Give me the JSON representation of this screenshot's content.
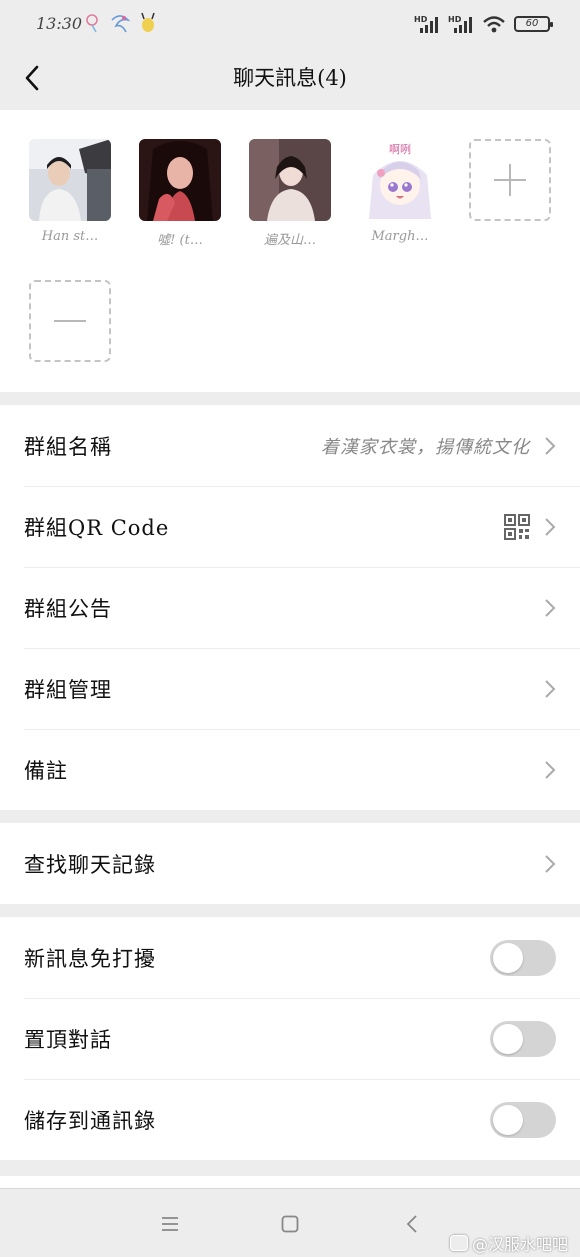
{
  "status_bar": {
    "time": "13:30",
    "network_1": "HD",
    "network_2": "HD",
    "battery": "60"
  },
  "nav": {
    "title": "聊天訊息(4)"
  },
  "members": [
    {
      "name": "Han st…",
      "avatar": "photo-avatar-young-man"
    },
    {
      "name": "噓! (t…",
      "avatar": "photo-avatar-woman-red"
    },
    {
      "name": "遍及山…",
      "avatar": "photo-avatar-woman-hanfu"
    },
    {
      "name": "Margh…",
      "avatar": "anime-avatar-girl"
    }
  ],
  "anime_caption": "啊咧",
  "group_settings": {
    "name_label": "群組名稱",
    "name_value": "着漢家衣裳，揚傳統文化",
    "qr_label": "群組QR Code",
    "notice_label": "群組公告",
    "manage_label": "群組管理",
    "remark_label": "備註"
  },
  "search": {
    "label": "查找聊天記錄"
  },
  "toggles": [
    {
      "label": "新訊息免打擾",
      "on": false
    },
    {
      "label": "置頂對話",
      "on": false
    },
    {
      "label": "儲存到通訊錄",
      "on": false
    }
  ],
  "watermark": "@汉服水吧吧",
  "colors": {
    "background": "#ededed",
    "card": "#ffffff",
    "toggle_off": "#d4d4d4",
    "muted_text": "#888888"
  }
}
